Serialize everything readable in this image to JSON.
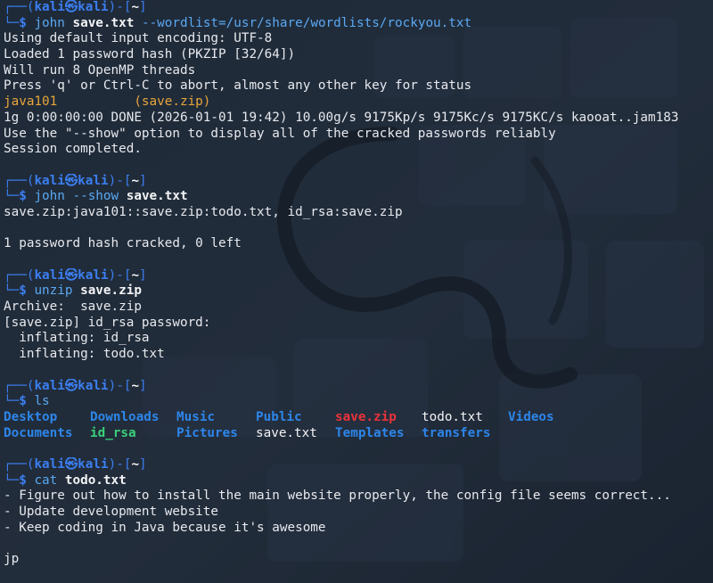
{
  "prompt": {
    "corner_top": "┌──(",
    "user": "kali",
    "skull": "㉿",
    "host": "kali",
    "mid": ")-[",
    "path": "~",
    "close": "]",
    "corner_bottom": "└─",
    "dollar": "$"
  },
  "blocks": [
    {
      "cmd": "john",
      "arg_bold": "save.txt",
      "arg_rest": "--wordlist=/usr/share/wordlists/rockyou.txt",
      "output": [
        {
          "text": "Using default input encoding: UTF-8"
        },
        {
          "text": "Loaded 1 password hash (PKZIP [32/64])"
        },
        {
          "text": "Will run 8 OpenMP threads"
        },
        {
          "text": "Press 'q' or Ctrl-C to abort, almost any other key for status"
        },
        {
          "text": "java101          (save.zip)",
          "color": "orange"
        },
        {
          "text": "1g 0:00:00:00 DONE (2026-01-01 19:42) 10.00g/s 9175Kp/s 9175Kc/s 9175KC/s kaooat..jam183"
        },
        {
          "text": "Use the \"--show\" option to display all of the cracked passwords reliably"
        },
        {
          "text": "Session completed."
        }
      ]
    },
    {
      "cmd": "john --show",
      "arg_bold": "save.txt",
      "arg_rest": "",
      "output": [
        {
          "text": "save.zip:java101::save.zip:todo.txt, id_rsa:save.zip"
        },
        {
          "text": ""
        },
        {
          "text": "1 password hash cracked, 0 left"
        }
      ]
    },
    {
      "cmd": "unzip",
      "arg_bold": "save.zip",
      "arg_rest": "",
      "output": [
        {
          "text": "Archive:  save.zip"
        },
        {
          "text": "[save.zip] id_rsa password:"
        },
        {
          "text": "  inflating: id_rsa"
        },
        {
          "text": "  inflating: todo.txt"
        }
      ]
    },
    {
      "cmd": "ls",
      "arg_bold": "",
      "arg_rest": "",
      "ls": [
        [
          "Desktop",
          "Downloads",
          "Music",
          "Public",
          "save.zip",
          "todo.txt",
          "Videos"
        ],
        [
          "Documents",
          "id_rsa",
          "Pictures",
          "save.txt",
          "Templates",
          "transfers"
        ]
      ]
    },
    {
      "cmd": "cat",
      "arg_bold": "",
      "arg_rest": "todo.txt",
      "output": [
        {
          "text": "- Figure out how to install the main website properly, the config file seems correct..."
        },
        {
          "text": "- Update development website"
        },
        {
          "text": "- Keep coding in Java because it's awesome"
        },
        {
          "text": ""
        },
        {
          "text": "jp"
        }
      ]
    }
  ],
  "colors": {
    "background": "#1b2532",
    "prompt_blue": "#3b7ef0",
    "command_cyan": "#5aa8f2",
    "directory_blue": "#2d86ea",
    "archive_red": "#e8333a",
    "cracked_orange": "#e7a53a",
    "text": "#e7e9ee"
  }
}
